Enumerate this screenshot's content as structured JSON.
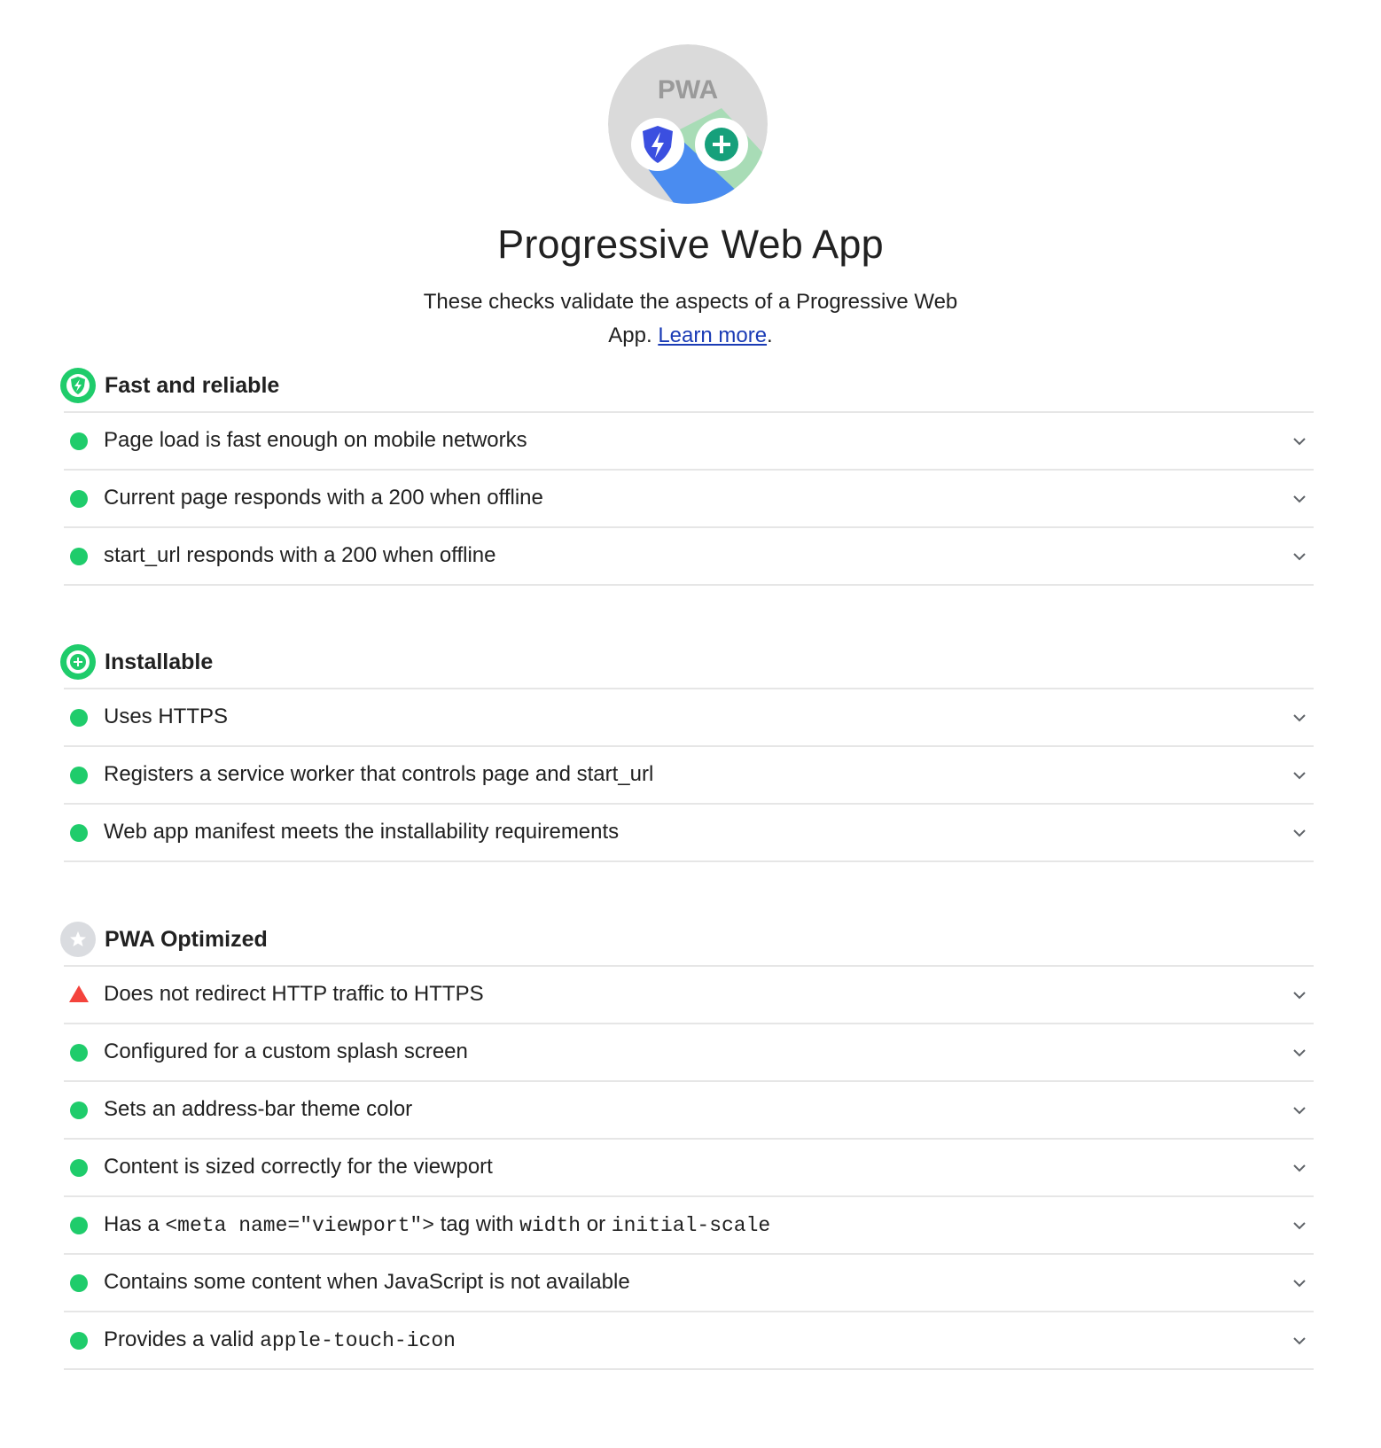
{
  "category": {
    "badge_text": "PWA",
    "title": "Progressive Web App",
    "description": "These checks validate the aspects of a Progressive Web App.",
    "learn_more_label": "Learn more",
    "description_suffix": "."
  },
  "colors": {
    "pass": "#1fcc6b",
    "fail": "#f4433c",
    "link": "#1a3bb5",
    "divider": "#e6e6e6",
    "optimized_icon": "#dadce0"
  },
  "groups": [
    {
      "title": "Fast and reliable",
      "icon": "lightning-badge-icon",
      "audits": [
        {
          "status": "pass",
          "parts": [
            {
              "t": "Page load is fast enough on mobile networks"
            }
          ]
        },
        {
          "status": "pass",
          "parts": [
            {
              "t": "Current page responds with a 200 when offline"
            }
          ]
        },
        {
          "status": "pass",
          "parts": [
            {
              "t": "start_url responds with a 200 when offline"
            }
          ]
        }
      ]
    },
    {
      "title": "Installable",
      "icon": "plus-badge-icon",
      "audits": [
        {
          "status": "pass",
          "parts": [
            {
              "t": "Uses HTTPS"
            }
          ]
        },
        {
          "status": "pass",
          "parts": [
            {
              "t": "Registers a service worker that controls page and start_url"
            }
          ]
        },
        {
          "status": "pass",
          "parts": [
            {
              "t": "Web app manifest meets the installability requirements"
            }
          ]
        }
      ]
    },
    {
      "title": "PWA Optimized",
      "icon": "star-badge-icon",
      "audits": [
        {
          "status": "fail",
          "parts": [
            {
              "t": "Does not redirect HTTP traffic to HTTPS"
            }
          ]
        },
        {
          "status": "pass",
          "parts": [
            {
              "t": "Configured for a custom splash screen"
            }
          ]
        },
        {
          "status": "pass",
          "parts": [
            {
              "t": "Sets an address-bar theme color"
            }
          ]
        },
        {
          "status": "pass",
          "parts": [
            {
              "t": "Content is sized correctly for the viewport"
            }
          ]
        },
        {
          "status": "pass",
          "parts": [
            {
              "t": "Has a "
            },
            {
              "t": "<meta name=\"viewport\">",
              "code": true
            },
            {
              "t": " tag with "
            },
            {
              "t": "width",
              "code": true
            },
            {
              "t": " or "
            },
            {
              "t": "initial-scale",
              "code": true
            }
          ]
        },
        {
          "status": "pass",
          "parts": [
            {
              "t": "Contains some content when JavaScript is not available"
            }
          ]
        },
        {
          "status": "pass",
          "parts": [
            {
              "t": "Provides a valid "
            },
            {
              "t": "apple-touch-icon",
              "code": true
            }
          ]
        }
      ]
    }
  ]
}
